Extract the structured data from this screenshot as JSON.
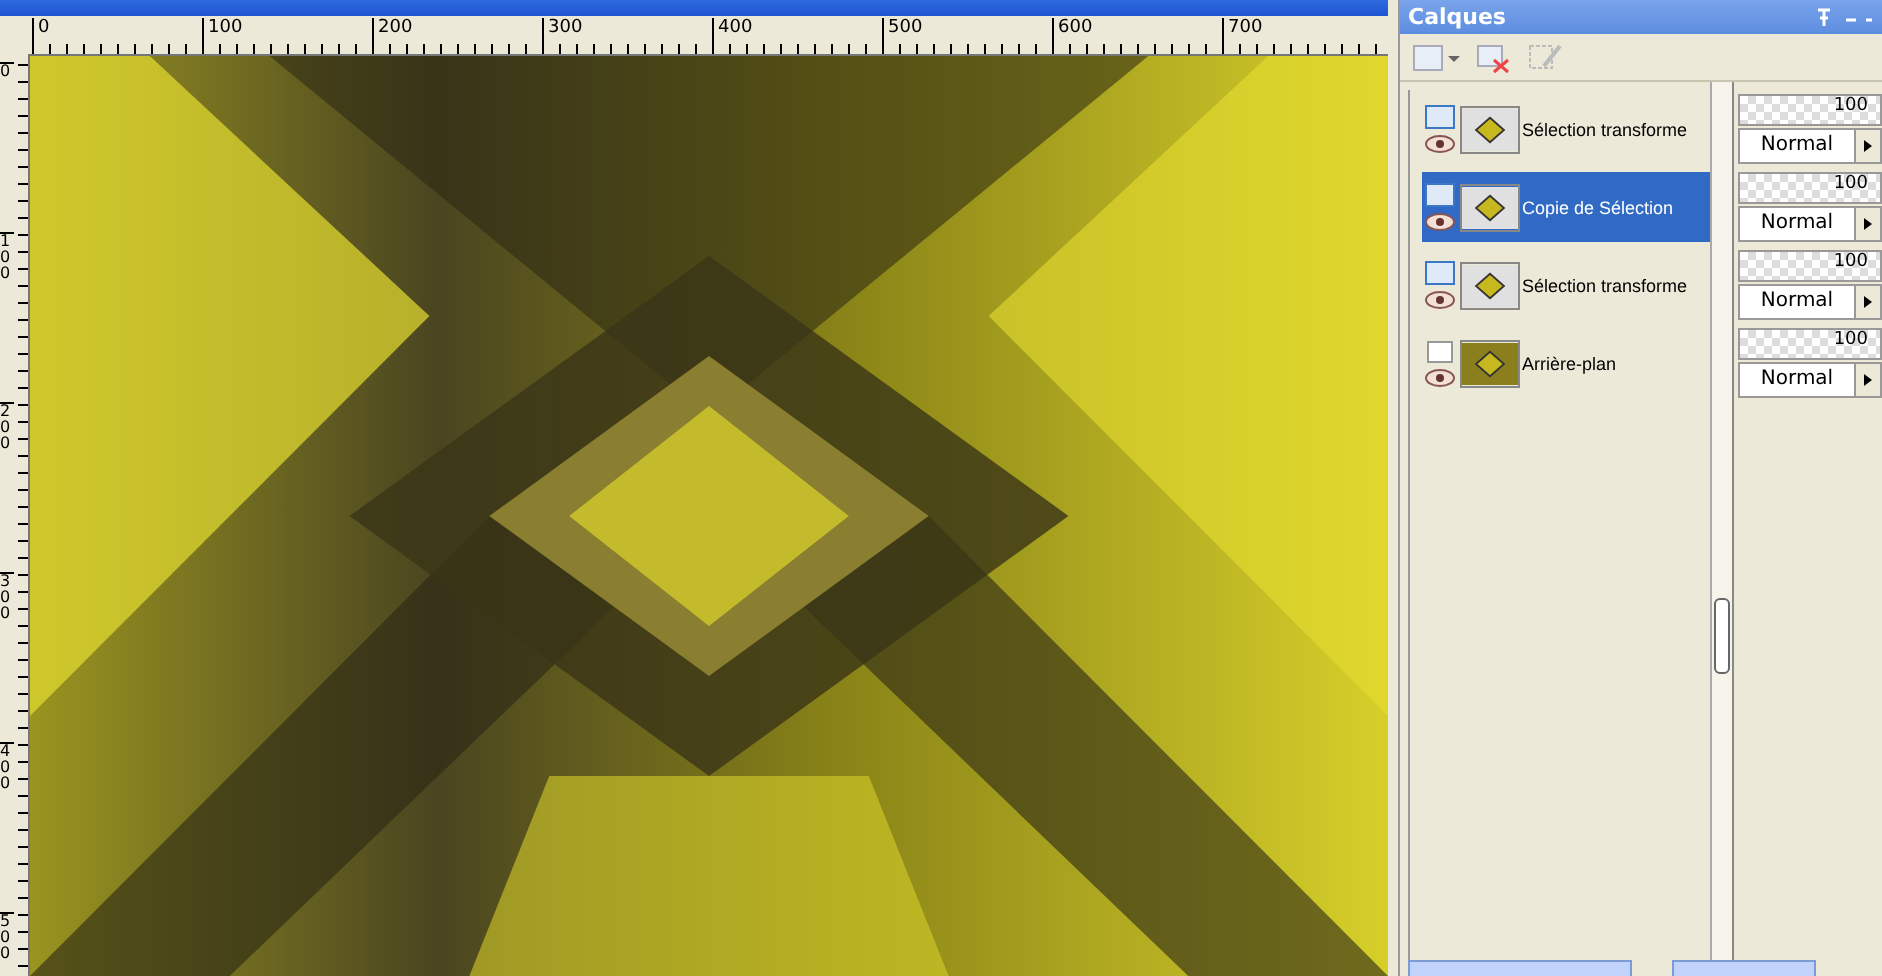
{
  "canvas_window": {
    "ruler_horizontal": [
      "0",
      "100",
      "200",
      "300",
      "400",
      "500",
      "600",
      "700"
    ],
    "ruler_vertical": [
      "0",
      "100",
      "200",
      "300",
      "400",
      "500"
    ]
  },
  "layers_panel": {
    "title": "Calques",
    "layers": [
      {
        "name": "Sélection transforme",
        "kind": "raster",
        "selected": false,
        "opacity": "100",
        "blend": "Normal"
      },
      {
        "name": "Copie de Sélection",
        "kind": "raster",
        "selected": true,
        "opacity": "100",
        "blend": "Normal"
      },
      {
        "name": "Sélection transforme",
        "kind": "raster",
        "selected": false,
        "opacity": "100",
        "blend": "Normal"
      },
      {
        "name": "Arrière-plan",
        "kind": "background",
        "selected": false,
        "opacity": "100",
        "blend": "Normal"
      }
    ]
  }
}
